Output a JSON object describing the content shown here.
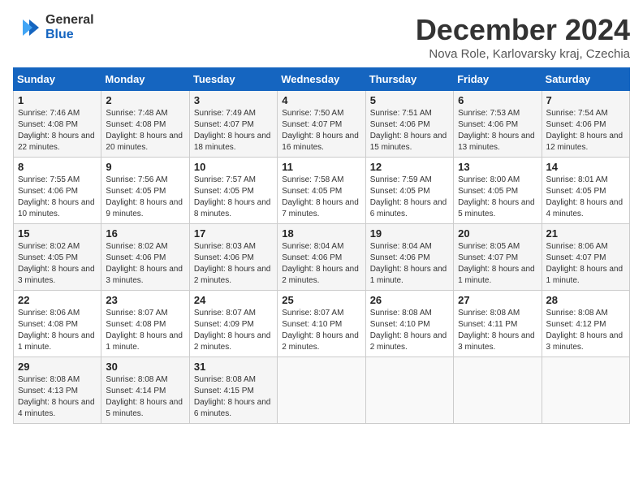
{
  "header": {
    "logo_line1": "General",
    "logo_line2": "Blue",
    "month_title": "December 2024",
    "location": "Nova Role, Karlovarsky kraj, Czechia"
  },
  "days_of_week": [
    "Sunday",
    "Monday",
    "Tuesday",
    "Wednesday",
    "Thursday",
    "Friday",
    "Saturday"
  ],
  "weeks": [
    [
      {
        "day": "1",
        "sunrise": "7:46 AM",
        "sunset": "4:08 PM",
        "daylight": "8 hours and 22 minutes."
      },
      {
        "day": "2",
        "sunrise": "7:48 AM",
        "sunset": "4:08 PM",
        "daylight": "8 hours and 20 minutes."
      },
      {
        "day": "3",
        "sunrise": "7:49 AM",
        "sunset": "4:07 PM",
        "daylight": "8 hours and 18 minutes."
      },
      {
        "day": "4",
        "sunrise": "7:50 AM",
        "sunset": "4:07 PM",
        "daylight": "8 hours and 16 minutes."
      },
      {
        "day": "5",
        "sunrise": "7:51 AM",
        "sunset": "4:06 PM",
        "daylight": "8 hours and 15 minutes."
      },
      {
        "day": "6",
        "sunrise": "7:53 AM",
        "sunset": "4:06 PM",
        "daylight": "8 hours and 13 minutes."
      },
      {
        "day": "7",
        "sunrise": "7:54 AM",
        "sunset": "4:06 PM",
        "daylight": "8 hours and 12 minutes."
      }
    ],
    [
      {
        "day": "8",
        "sunrise": "7:55 AM",
        "sunset": "4:06 PM",
        "daylight": "8 hours and 10 minutes."
      },
      {
        "day": "9",
        "sunrise": "7:56 AM",
        "sunset": "4:05 PM",
        "daylight": "8 hours and 9 minutes."
      },
      {
        "day": "10",
        "sunrise": "7:57 AM",
        "sunset": "4:05 PM",
        "daylight": "8 hours and 8 minutes."
      },
      {
        "day": "11",
        "sunrise": "7:58 AM",
        "sunset": "4:05 PM",
        "daylight": "8 hours and 7 minutes."
      },
      {
        "day": "12",
        "sunrise": "7:59 AM",
        "sunset": "4:05 PM",
        "daylight": "8 hours and 6 minutes."
      },
      {
        "day": "13",
        "sunrise": "8:00 AM",
        "sunset": "4:05 PM",
        "daylight": "8 hours and 5 minutes."
      },
      {
        "day": "14",
        "sunrise": "8:01 AM",
        "sunset": "4:05 PM",
        "daylight": "8 hours and 4 minutes."
      }
    ],
    [
      {
        "day": "15",
        "sunrise": "8:02 AM",
        "sunset": "4:05 PM",
        "daylight": "8 hours and 3 minutes."
      },
      {
        "day": "16",
        "sunrise": "8:02 AM",
        "sunset": "4:06 PM",
        "daylight": "8 hours and 3 minutes."
      },
      {
        "day": "17",
        "sunrise": "8:03 AM",
        "sunset": "4:06 PM",
        "daylight": "8 hours and 2 minutes."
      },
      {
        "day": "18",
        "sunrise": "8:04 AM",
        "sunset": "4:06 PM",
        "daylight": "8 hours and 2 minutes."
      },
      {
        "day": "19",
        "sunrise": "8:04 AM",
        "sunset": "4:06 PM",
        "daylight": "8 hours and 1 minute."
      },
      {
        "day": "20",
        "sunrise": "8:05 AM",
        "sunset": "4:07 PM",
        "daylight": "8 hours and 1 minute."
      },
      {
        "day": "21",
        "sunrise": "8:06 AM",
        "sunset": "4:07 PM",
        "daylight": "8 hours and 1 minute."
      }
    ],
    [
      {
        "day": "22",
        "sunrise": "8:06 AM",
        "sunset": "4:08 PM",
        "daylight": "8 hours and 1 minute."
      },
      {
        "day": "23",
        "sunrise": "8:07 AM",
        "sunset": "4:08 PM",
        "daylight": "8 hours and 1 minute."
      },
      {
        "day": "24",
        "sunrise": "8:07 AM",
        "sunset": "4:09 PM",
        "daylight": "8 hours and 2 minutes."
      },
      {
        "day": "25",
        "sunrise": "8:07 AM",
        "sunset": "4:10 PM",
        "daylight": "8 hours and 2 minutes."
      },
      {
        "day": "26",
        "sunrise": "8:08 AM",
        "sunset": "4:10 PM",
        "daylight": "8 hours and 2 minutes."
      },
      {
        "day": "27",
        "sunrise": "8:08 AM",
        "sunset": "4:11 PM",
        "daylight": "8 hours and 3 minutes."
      },
      {
        "day": "28",
        "sunrise": "8:08 AM",
        "sunset": "4:12 PM",
        "daylight": "8 hours and 3 minutes."
      }
    ],
    [
      {
        "day": "29",
        "sunrise": "8:08 AM",
        "sunset": "4:13 PM",
        "daylight": "8 hours and 4 minutes."
      },
      {
        "day": "30",
        "sunrise": "8:08 AM",
        "sunset": "4:14 PM",
        "daylight": "8 hours and 5 minutes."
      },
      {
        "day": "31",
        "sunrise": "8:08 AM",
        "sunset": "4:15 PM",
        "daylight": "8 hours and 6 minutes."
      },
      null,
      null,
      null,
      null
    ]
  ]
}
